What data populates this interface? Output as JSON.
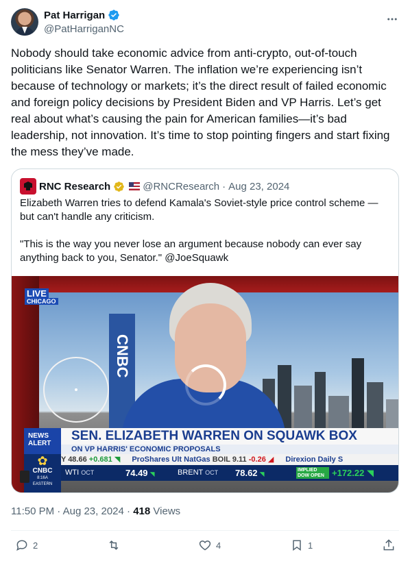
{
  "author": {
    "display_name": "Pat Harrigan",
    "handle": "@PatHarriganNC",
    "verified": true,
    "verified_color": "#1d9bf0"
  },
  "tweet": {
    "text": "Nobody should take economic advice from anti-crypto, out-of-touch politicians like Senator Warren. The inflation we’re experiencing isn’t because of technology or markets; it’s the direct result of failed economic and foreign policy decisions by President Biden and VP Harris. Let’s get real about what’s causing the pain for American families—it’s bad leadership, not innovation. It’s time to stop pointing fingers and start fixing the mess they’ve made."
  },
  "quote": {
    "display_name": "RNC Research",
    "handle": "@RNCResearch",
    "separator": "·",
    "date": "Aug 23, 2024",
    "verified_color": "#e2b719",
    "paragraph_1": "Elizabeth Warren tries to defend Kamala's Soviet-style price control scheme — but can't handle any criticism.",
    "paragraph_2": "\"This is the way you never lose an argument because nobody can ever say anything back to you, Senator.\" @JoeSquawk",
    "video": {
      "live_label": "LIVE",
      "live_city": "CHICAGO",
      "pillar_text": "CNBC",
      "news_alert": "NEWS ALERT",
      "headline": "SEN. ELIZABETH WARREN ON SQUAWK BOX",
      "subheadline": "ON VP HARRIS' ECONOMIC PROPOSALS",
      "logo_text": "CNBC",
      "logo_time": "8:16A",
      "logo_zone": "EASTERN",
      "ticker": {
        "item1_prefix": "Y 48.66",
        "item1_change": "+0.681",
        "item2_name": "ProShares Ult NatGas",
        "item2_symbol": "BOIL 9.11",
        "item2_change": "-0.26",
        "item3_name": "Direxion Daily S"
      },
      "markets": {
        "wti_label": "WTI",
        "wti_month": "OCT",
        "wti_value": "74.49",
        "brent_label": "BRENT",
        "brent_month": "OCT",
        "brent_value": "78.62",
        "implied_line1": "IMPLIED",
        "implied_line2": "DOW OPEN",
        "implied_value": "+172.22"
      }
    }
  },
  "meta": {
    "time": "11:50 PM",
    "dot": "·",
    "date": "Aug 23, 2024",
    "views_count": "418",
    "views_label": "Views"
  },
  "actions": {
    "reply_count": "2",
    "retweet_count": "",
    "like_count": "4",
    "bookmark_count": "1"
  },
  "colors": {
    "text_primary": "#0f1419",
    "text_secondary": "#536471",
    "border": "#cfd9de"
  }
}
